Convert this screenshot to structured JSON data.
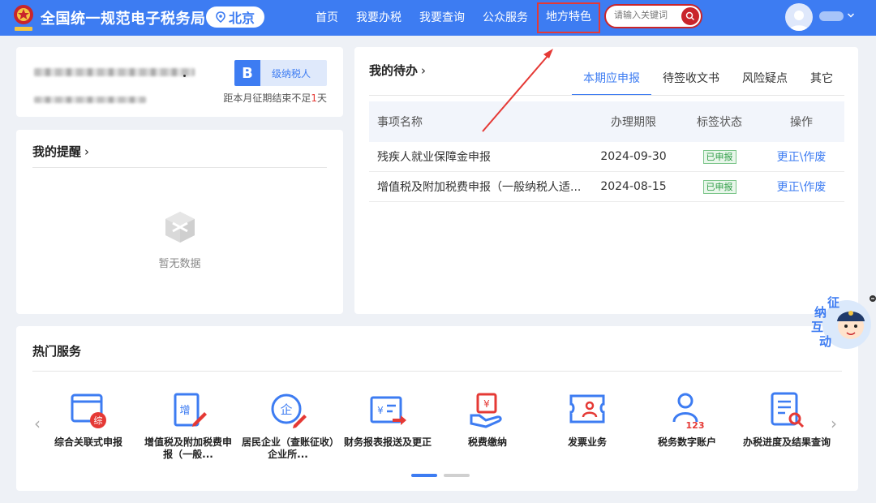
{
  "header": {
    "site_title": "全国统一规范电子税务局",
    "region": "北京",
    "nav": [
      "首页",
      "我要办税",
      "我要查询",
      "公众服务",
      "地方特色"
    ],
    "search_placeholder": "请输入关键词",
    "accent_color": "#3d7cf2",
    "highlighted_nav": "地方特色"
  },
  "profile": {
    "grade_letter": "B",
    "grade_label": "级纳税人",
    "deadline_prefix": "距本月征期结束不足",
    "deadline_days": "1",
    "deadline_suffix": "天"
  },
  "reminders": {
    "title": "我的提醒",
    "empty_text": "暂无数据"
  },
  "todo": {
    "title": "我的待办",
    "tabs": [
      "本期应申报",
      "待签收文书",
      "风险疑点",
      "其它"
    ],
    "active_tab": "本期应申报",
    "columns": [
      "事项名称",
      "办理期限",
      "标签状态",
      "操作"
    ],
    "rows": [
      {
        "name": "残疾人就业保障金申报",
        "deadline": "2024-09-30",
        "status": "已申报",
        "action": "更正\\作废"
      },
      {
        "name": "增值税及附加税费申报（一般纳税人适...",
        "deadline": "2024-08-15",
        "status": "已申报",
        "action": "更正\\作废"
      }
    ]
  },
  "hot_services": {
    "title": "热门服务",
    "items": [
      {
        "label": "综合关联式申报",
        "icon": "composite-declare-icon"
      },
      {
        "label": "增值税及附加税费申报（一般...",
        "icon": "vat-declare-icon"
      },
      {
        "label": "居民企业（查账征收）企业所...",
        "icon": "enterprise-tax-icon"
      },
      {
        "label": "财务报表报送及更正",
        "icon": "financial-report-icon"
      },
      {
        "label": "税费缴纳",
        "icon": "tax-payment-icon"
      },
      {
        "label": "发票业务",
        "icon": "invoice-icon"
      },
      {
        "label": "税务数字账户",
        "icon": "digital-account-icon"
      },
      {
        "label": "办税进度及结果查询",
        "icon": "progress-query-icon"
      }
    ],
    "page_count": 2,
    "active_page": 1
  },
  "float_widget": {
    "chars": [
      "征",
      "纳",
      "互",
      "动"
    ]
  }
}
